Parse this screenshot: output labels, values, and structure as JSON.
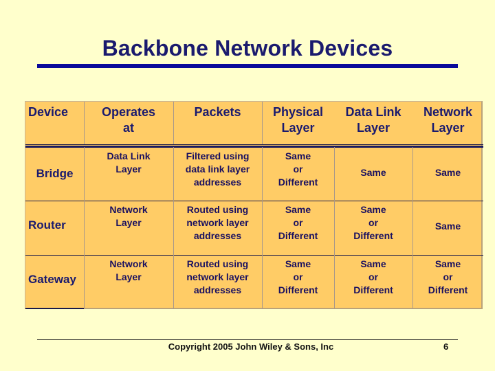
{
  "slide": {
    "title": "Backbone Network Devices",
    "footer": "Copyright 2005 John Wiley & Sons, Inc",
    "page_number": "6"
  },
  "colors": {
    "background": "#FFFFCC",
    "table_fill": "#FFCC66",
    "title_rule": "#0A0A9A",
    "text": "#1A1A6E"
  },
  "table": {
    "headers": [
      "Device",
      "Operates at",
      "Packets",
      "Physical Layer",
      "Data Link Layer",
      "Network Layer"
    ],
    "header_lines": [
      [
        "Device"
      ],
      [
        "Operates",
        "at"
      ],
      [
        "Packets"
      ],
      [
        "Physical",
        "Layer"
      ],
      [
        "Data Link",
        "Layer"
      ],
      [
        "Network",
        "Layer"
      ]
    ],
    "rows": [
      {
        "device": "Bridge",
        "operates_at": [
          "Data Link",
          "Layer"
        ],
        "packets": [
          "Filtered using",
          "data link layer",
          "addresses"
        ],
        "physical_layer": [
          "Same",
          "or",
          "Different"
        ],
        "data_link_layer": [
          "Same"
        ],
        "network_layer": [
          "Same"
        ]
      },
      {
        "device": "Router",
        "operates_at": [
          "Network",
          "Layer"
        ],
        "packets": [
          "Routed using",
          "network layer",
          "addresses"
        ],
        "physical_layer": [
          "Same",
          "or",
          "Different"
        ],
        "data_link_layer": [
          "Same",
          "or",
          "Different"
        ],
        "network_layer": [
          "Same"
        ]
      },
      {
        "device": "Gateway",
        "operates_at": [
          "Network",
          "Layer"
        ],
        "packets": [
          "Routed using",
          "network layer",
          "addresses"
        ],
        "physical_layer": [
          "Same",
          "or",
          "Different"
        ],
        "data_link_layer": [
          "Same",
          "or",
          "Different"
        ],
        "network_layer": [
          "Same",
          "or",
          "Different"
        ]
      }
    ]
  }
}
